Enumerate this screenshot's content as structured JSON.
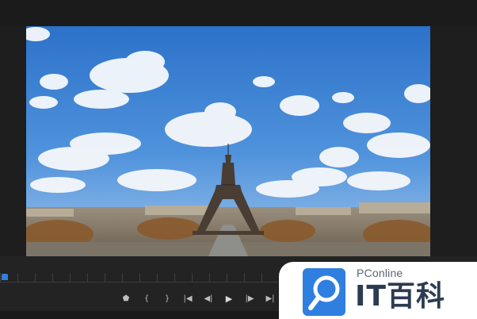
{
  "player": {
    "controls": [
      {
        "name": "add-marker-button",
        "glyph": "⬟"
      },
      {
        "name": "mark-in-button",
        "glyph": "{"
      },
      {
        "name": "mark-out-button",
        "glyph": "}"
      },
      {
        "name": "go-to-in-button",
        "glyph": "|◀"
      },
      {
        "name": "step-back-button",
        "glyph": "◀|"
      },
      {
        "name": "play-button",
        "glyph": "▶"
      },
      {
        "name": "step-forward-button",
        "glyph": "|▶"
      },
      {
        "name": "go-to-out-button",
        "glyph": "▶|"
      }
    ],
    "playhead_color": "#2f7fe0"
  },
  "watermark": {
    "brand": "PConline",
    "name_cn": "IT百科",
    "logo_color": "#2e7fe0"
  }
}
